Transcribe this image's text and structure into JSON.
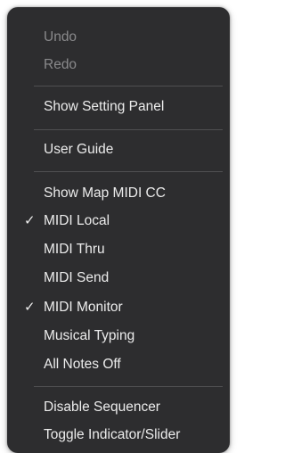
{
  "menu": {
    "undo": "Undo",
    "redo": "Redo",
    "show_setting_panel": "Show Setting Panel",
    "user_guide": "User Guide",
    "show_map_midi_cc": "Show Map MIDI CC",
    "midi_local": "MIDI Local",
    "midi_thru": "MIDI Thru",
    "midi_send": "MIDI Send",
    "midi_monitor": "MIDI Monitor",
    "musical_typing": "Musical Typing",
    "all_notes_off": "All Notes Off",
    "disable_sequencer": "Disable Sequencer",
    "toggle_indicator_slider": "Toggle Indicator/Slider",
    "checkmark": "✓"
  }
}
